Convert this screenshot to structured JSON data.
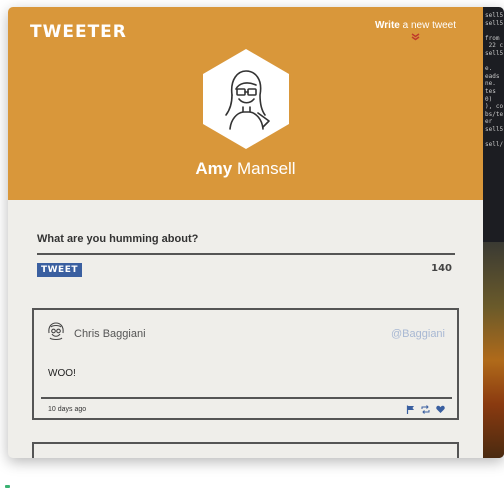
{
  "app": {
    "logo": "TWEETER",
    "write_bold": "Write",
    "write_rest": " a new tweet",
    "chevron": "⌄"
  },
  "profile": {
    "first_name": "Amy",
    "last_name": "Mansell"
  },
  "compose": {
    "prompt": "What are you humming about?",
    "button_label": "TWEET",
    "char_count": "140"
  },
  "tweets": [
    {
      "author": "Chris Baggiani",
      "handle": "@Baggiani",
      "text": "WOO!",
      "time": "10 days ago"
    }
  ],
  "terminal": {
    "lines": [
      "sell5",
      "sell5",
      "",
      "from",
      " 22 c",
      "sell5",
      "",
      "e.",
      "eads",
      "ne.",
      "tes",
      "0)",
      "), co",
      "bs/te",
      "er",
      "sell5",
      "",
      "sell/"
    ]
  },
  "colors": {
    "header": "#d9973a",
    "body": "#efeeea",
    "tweet_button": "#3a5fa0",
    "handle": "#a8b8d3",
    "chevron": "#c0392b"
  }
}
